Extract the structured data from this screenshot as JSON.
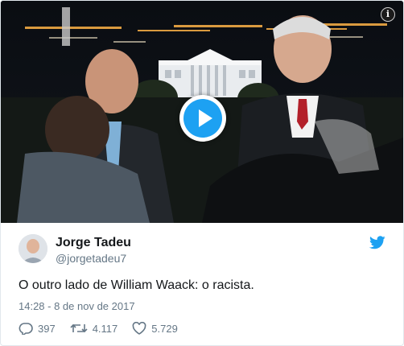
{
  "media": {
    "play_icon": "play-icon",
    "info_icon": "info-icon",
    "info_glyph": "i",
    "accent_color": "#1da1f2"
  },
  "tweet": {
    "author_name": "Jorge Tadeu",
    "handle": "@jorgetadeu7",
    "text": "O outro lado de William Waack: o racista.",
    "timestamp": "14:28 - 8 de nov de 2017",
    "bird_icon": "twitter-bird-icon",
    "colors": {
      "name": "#14171a",
      "secondary": "#657786",
      "brand": "#1da1f2"
    }
  },
  "actions": {
    "replies": {
      "icon": "reply-icon",
      "count": "397"
    },
    "retweets": {
      "icon": "retweet-icon",
      "count": "4.117"
    },
    "likes": {
      "icon": "heart-icon",
      "count": "5.729"
    }
  }
}
